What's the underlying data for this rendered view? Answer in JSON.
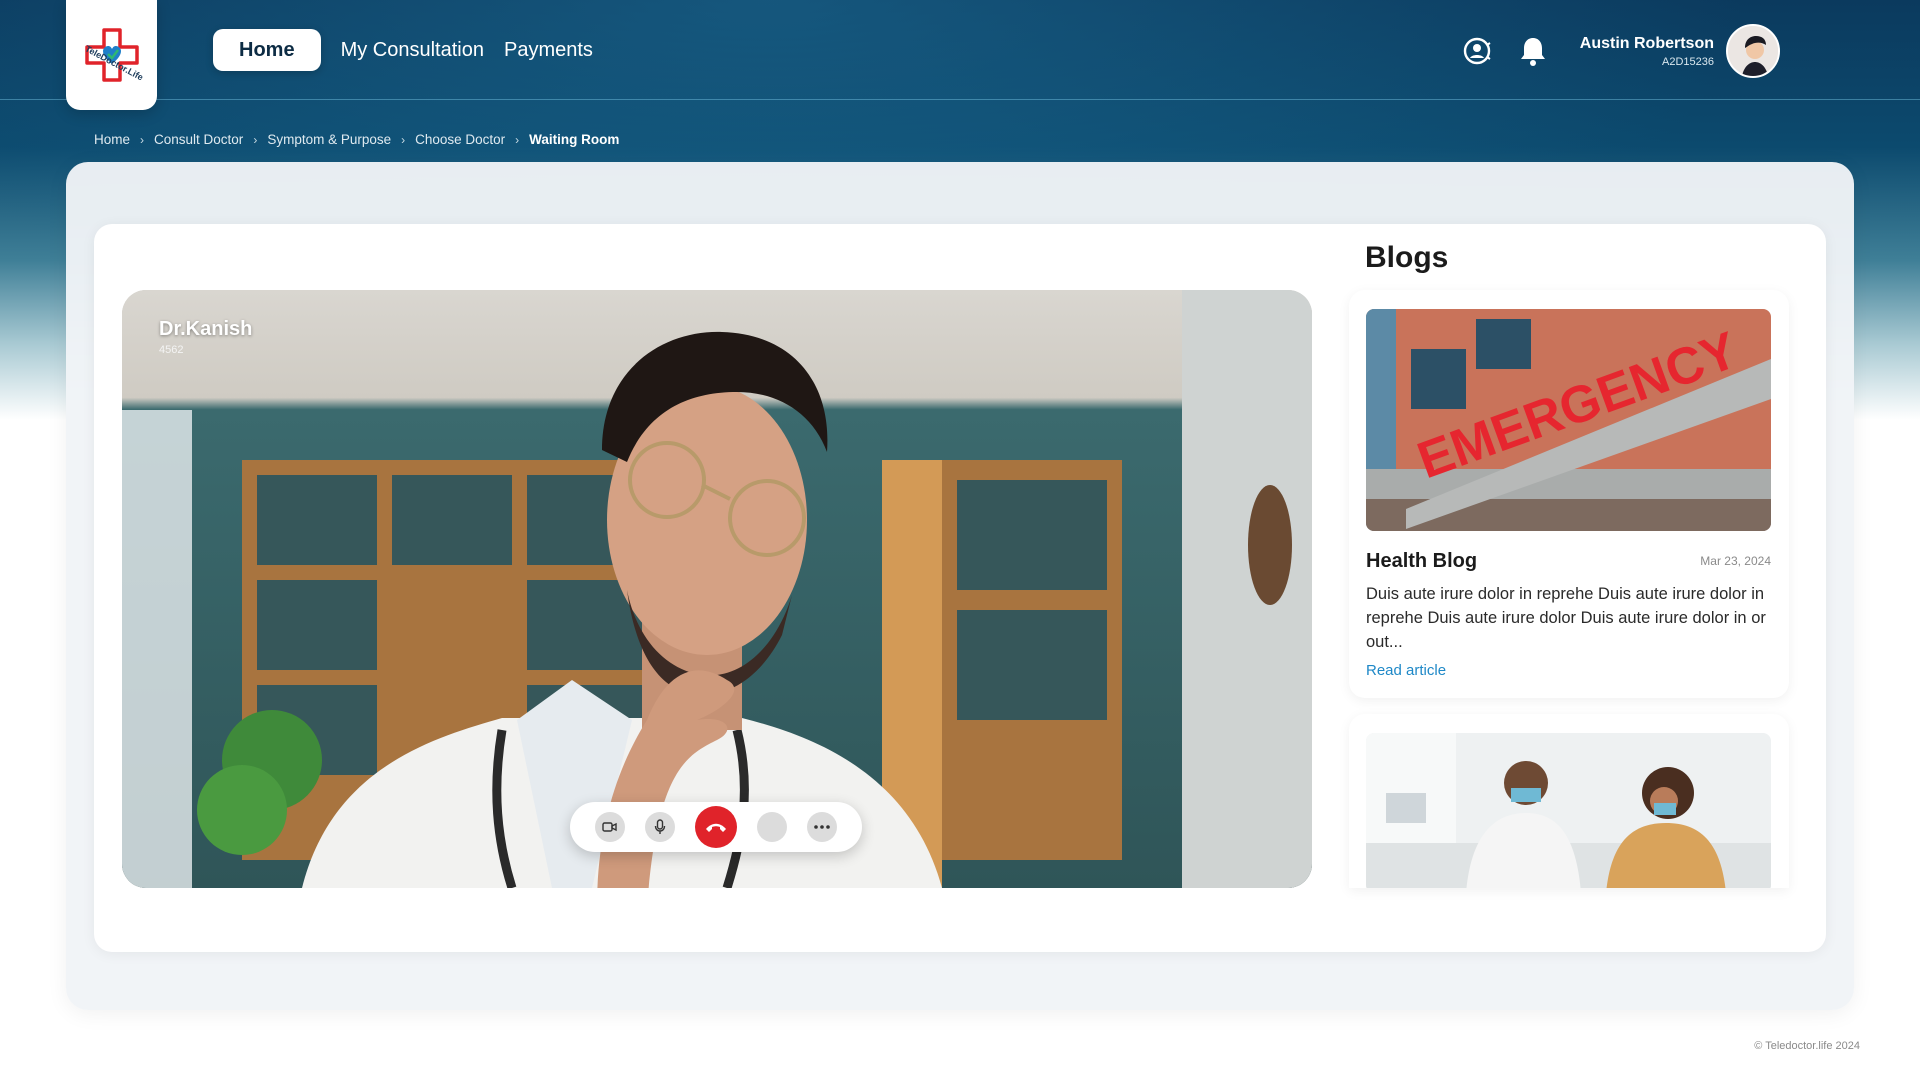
{
  "header": {
    "logo_text": "TeleDoctor.Life",
    "nav": {
      "home": "Home",
      "consultation": "My Consultation",
      "payments": "Payments"
    },
    "user": {
      "name": "Austin Robertson",
      "id": "A2D15236"
    }
  },
  "breadcrumb": {
    "items": [
      "Home",
      "Consult Doctor",
      "Symptom & Purpose",
      "Choose Doctor"
    ],
    "current": "Waiting Room"
  },
  "video": {
    "doctor_name": "Dr.Kanish",
    "doctor_id": "4562"
  },
  "blogs": {
    "title": "Blogs",
    "cards": [
      {
        "image_text": "EMERGENCY",
        "title": "Health Blog",
        "date": "Mar 23, 2024",
        "excerpt": "Duis aute irure dolor in reprehe Duis aute irure dolor in reprehe Duis aute irure dolor Duis aute irure dolor in or out...",
        "link": "Read article"
      }
    ]
  },
  "footer": {
    "copyright": "© Teledoctor.life 2024"
  },
  "colors": {
    "header_bg": "#0b3a5e",
    "end_call": "#e0232a",
    "link": "#1e88c7"
  }
}
